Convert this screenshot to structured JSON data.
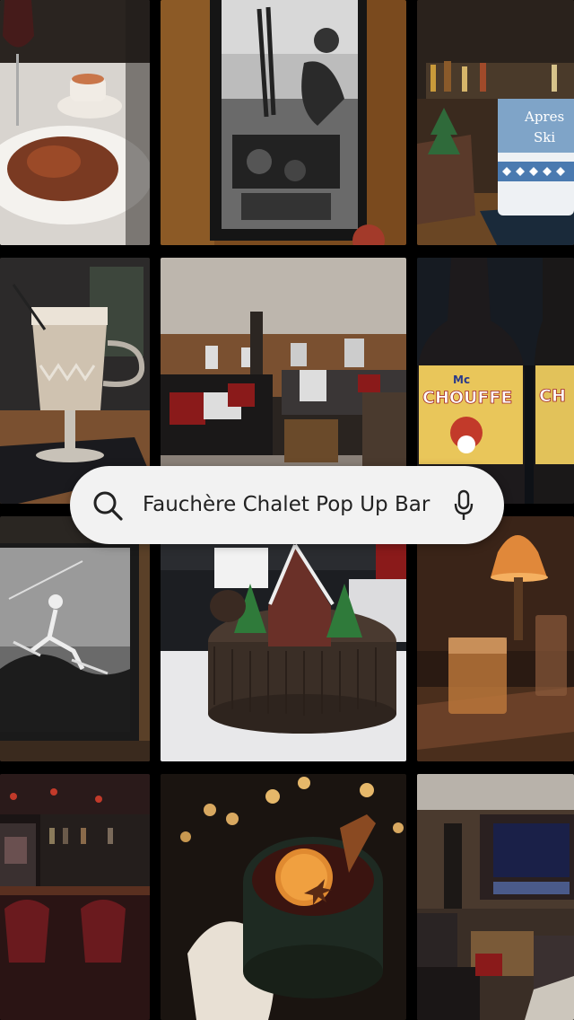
{
  "search": {
    "query": "Fauchère Chalet Pop Up Bar",
    "search_icon": "search-icon",
    "mic_icon": "microphone-icon"
  },
  "tiles": [
    {
      "name": "photo-dinner-plate",
      "subject": "plated food with wine glass"
    },
    {
      "name": "photo-ski-poster",
      "subject": "black and white framed ski photo"
    },
    {
      "name": "photo-apres-ski-mug",
      "subject": "Apres Ski mug with tree decoration"
    },
    {
      "name": "photo-irish-coffee",
      "subject": "creamy drink in glass mug"
    },
    {
      "name": "photo-lounge-room",
      "subject": "chalet lounge with sofas"
    },
    {
      "name": "photo-chouffe-bottles",
      "subject": "Mc Chouffe beer bottles"
    },
    {
      "name": "photo-skier-poster",
      "subject": "vintage skier artwork"
    },
    {
      "name": "photo-chalet-centerpiece",
      "subject": "miniature chalet and trees on log"
    },
    {
      "name": "photo-whisky-lamp",
      "subject": "glasses of spirits under warm lamp"
    },
    {
      "name": "photo-bar-interior",
      "subject": "bar with red velvet seats"
    },
    {
      "name": "photo-mulled-wine",
      "subject": "mulled wine with orange and cinnamon"
    },
    {
      "name": "photo-fireplace-lounge",
      "subject": "lounge with electric fireplace"
    }
  ],
  "labels": {
    "mug_text_1": "Apres",
    "mug_text_2": "Ski",
    "bottle_text_1": "Mc",
    "bottle_text_2": "CHOUFFE",
    "bottle_text_3": "CH"
  }
}
